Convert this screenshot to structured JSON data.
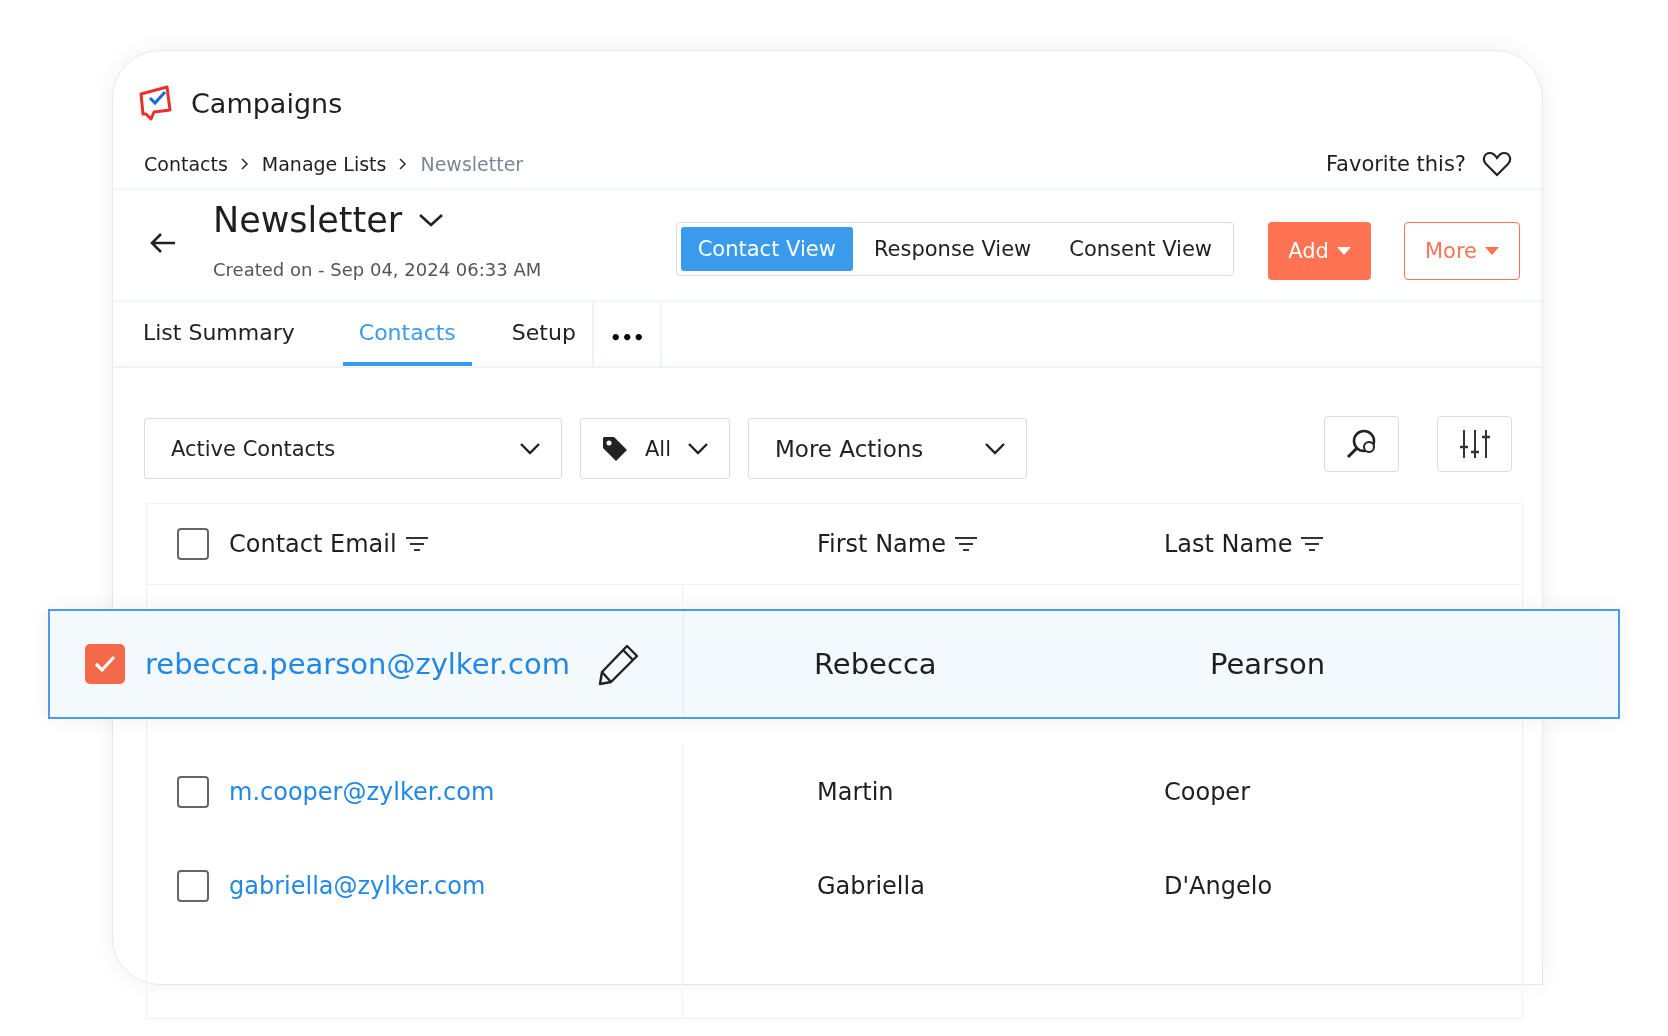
{
  "app": {
    "name": "Campaigns"
  },
  "breadcrumb": [
    {
      "label": "Contacts",
      "current": false
    },
    {
      "label": "Manage Lists",
      "current": false
    },
    {
      "label": "Newsletter",
      "current": true
    }
  ],
  "favorite": {
    "label": "Favorite this?",
    "on": false
  },
  "header": {
    "title": "Newsletter",
    "created": "Created on - Sep 04, 2024 06:33 AM"
  },
  "view_toggle": [
    {
      "label": "Contact View",
      "selected": true
    },
    {
      "label": "Response View",
      "selected": false
    },
    {
      "label": "Consent View",
      "selected": false
    }
  ],
  "buttons": {
    "add": "Add",
    "more": "More"
  },
  "tabs": [
    {
      "label": "List Summary",
      "selected": false
    },
    {
      "label": "Contacts",
      "selected": true
    },
    {
      "label": "Setup",
      "selected": false
    }
  ],
  "tabs_more": "•••",
  "filters": {
    "list": "Active Contacts",
    "tag": "All",
    "actions": "More Actions"
  },
  "table": {
    "header_checked": false,
    "columns": [
      "Contact Email",
      "First Name",
      "Last Name"
    ],
    "rows": [
      {
        "email": "rebecca.pearson@zylker.com",
        "first": "Rebecca",
        "last": "Pearson",
        "selected": true,
        "checked": true
      },
      {
        "email": "m.cooper@zylker.com",
        "first": "Martin",
        "last": "Cooper",
        "selected": false,
        "checked": false
      },
      {
        "email": "gabriella@zylker.com",
        "first": "Gabriella",
        "last": "D'Angelo",
        "selected": false,
        "checked": false
      }
    ]
  }
}
